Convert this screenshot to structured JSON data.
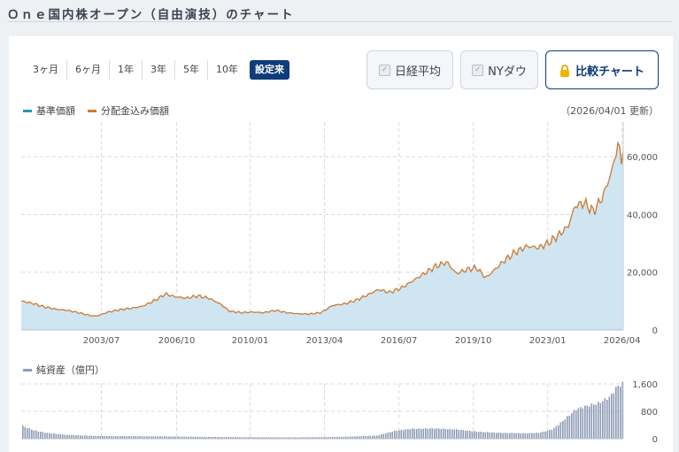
{
  "header": {
    "title": "Ｏｎｅ国内株オープン（自由演技）のチャート"
  },
  "periods": [
    {
      "label": "3ヶ月",
      "active": false
    },
    {
      "label": "6ヶ月",
      "active": false
    },
    {
      "label": "1年",
      "active": false
    },
    {
      "label": "3年",
      "active": false
    },
    {
      "label": "5年",
      "active": false
    },
    {
      "label": "10年",
      "active": false
    },
    {
      "label": "設定来",
      "active": true
    }
  ],
  "overlays": {
    "nikkei_label": "日経平均",
    "nydow_label": "NYダウ"
  },
  "compare_button": {
    "label": "比較チャート"
  },
  "legend": {
    "nav_label": "基準価額",
    "dividend_label": "分配金込み価額",
    "nav_color": "#1e9ab0",
    "dividend_color": "#d4782a"
  },
  "as_of": "（2026/04/01 更新）",
  "net_assets": {
    "label": "純資産（億円）",
    "color": "#8d9bb5"
  },
  "chart_data": [
    {
      "type": "area",
      "x_ticks": [
        "2003/07",
        "2006/10",
        "2010/01",
        "2013/04",
        "2016/07",
        "2019/10",
        "2023/01",
        "2026/04"
      ],
      "y_ticks": [
        "60,000",
        "40,000",
        "20,000",
        "0"
      ],
      "ylim": [
        0,
        72000
      ],
      "grid": true,
      "series": [
        {
          "name": "基準価額",
          "type": "area"
        },
        {
          "name": "分配金込み価額",
          "type": "line"
        }
      ],
      "points": [
        [
          2000.0,
          10000
        ],
        [
          2000.5,
          9200
        ],
        [
          2001.0,
          8000
        ],
        [
          2001.5,
          7200
        ],
        [
          2002.0,
          6800
        ],
        [
          2002.5,
          6000
        ],
        [
          2003.0,
          5000
        ],
        [
          2003.3,
          4800
        ],
        [
          2003.8,
          6200
        ],
        [
          2004.3,
          7000
        ],
        [
          2004.8,
          7500
        ],
        [
          2005.3,
          8200
        ],
        [
          2005.9,
          10500
        ],
        [
          2006.3,
          12500
        ],
        [
          2006.7,
          11500
        ],
        [
          2007.2,
          11000
        ],
        [
          2007.7,
          11800
        ],
        [
          2008.2,
          11000
        ],
        [
          2008.7,
          9000
        ],
        [
          2009.1,
          6500
        ],
        [
          2009.6,
          6000
        ],
        [
          2010.1,
          6200
        ],
        [
          2010.6,
          6000
        ],
        [
          2011.1,
          6800
        ],
        [
          2011.6,
          6000
        ],
        [
          2012.1,
          5600
        ],
        [
          2012.6,
          5500
        ],
        [
          2013.1,
          6000
        ],
        [
          2013.6,
          8500
        ],
        [
          2014.1,
          9000
        ],
        [
          2014.6,
          10200
        ],
        [
          2015.1,
          12000
        ],
        [
          2015.6,
          14000
        ],
        [
          2016.1,
          13000
        ],
        [
          2016.6,
          14500
        ],
        [
          2017.1,
          17000
        ],
        [
          2017.6,
          19500
        ],
        [
          2018.1,
          22000
        ],
        [
          2018.6,
          23500
        ],
        [
          2019.0,
          19500
        ],
        [
          2019.5,
          21000
        ],
        [
          2019.9,
          21500
        ],
        [
          2020.3,
          18000
        ],
        [
          2020.7,
          21000
        ],
        [
          2021.1,
          24000
        ],
        [
          2021.6,
          27000
        ],
        [
          2022.1,
          29000
        ],
        [
          2022.6,
          28500
        ],
        [
          2023.0,
          30000
        ],
        [
          2023.5,
          33000
        ],
        [
          2023.9,
          36000
        ],
        [
          2024.2,
          43000
        ],
        [
          2024.6,
          44000
        ],
        [
          2025.0,
          41000
        ],
        [
          2025.4,
          46000
        ],
        [
          2025.8,
          55000
        ],
        [
          2026.0,
          62000
        ],
        [
          2026.1,
          65000
        ],
        [
          2026.2,
          58000
        ],
        [
          2026.3,
          63000
        ]
      ]
    },
    {
      "type": "bar",
      "name": "純資産（億円）",
      "y_ticks": [
        "1,600",
        "800",
        "0"
      ],
      "ylim": [
        0,
        1600
      ],
      "points": [
        [
          2000.0,
          380
        ],
        [
          2000.5,
          250
        ],
        [
          2001.0,
          180
        ],
        [
          2001.5,
          140
        ],
        [
          2002.0,
          110
        ],
        [
          2003.0,
          85
        ],
        [
          2004.0,
          75
        ],
        [
          2006.0,
          70
        ],
        [
          2008.0,
          55
        ],
        [
          2010.0,
          45
        ],
        [
          2012.0,
          40
        ],
        [
          2014.0,
          55
        ],
        [
          2015.5,
          90
        ],
        [
          2016.3,
          230
        ],
        [
          2017.0,
          290
        ],
        [
          2018.0,
          300
        ],
        [
          2019.0,
          270
        ],
        [
          2020.0,
          200
        ],
        [
          2021.0,
          170
        ],
        [
          2022.0,
          160
        ],
        [
          2022.6,
          170
        ],
        [
          2023.2,
          280
        ],
        [
          2023.7,
          560
        ],
        [
          2024.2,
          860
        ],
        [
          2024.7,
          960
        ],
        [
          2025.2,
          1040
        ],
        [
          2025.7,
          1230
        ],
        [
          2026.0,
          1520
        ],
        [
          2026.3,
          1620
        ]
      ]
    }
  ]
}
